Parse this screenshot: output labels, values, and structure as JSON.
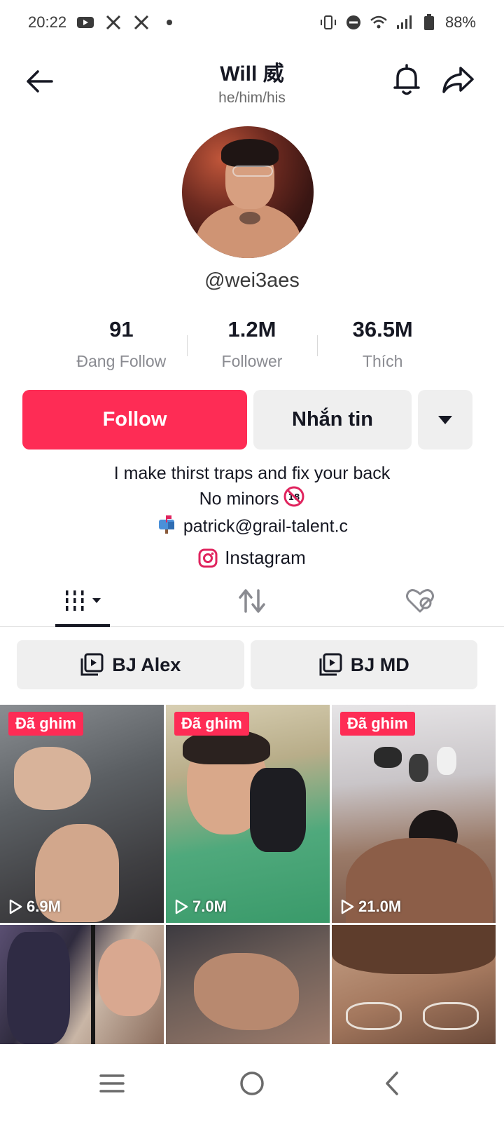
{
  "status_bar": {
    "time": "20:22",
    "battery": "88%",
    "icons_left": [
      "youtube-icon",
      "x-icon",
      "x-icon",
      "dot-icon"
    ],
    "icons_right": [
      "vibrate-icon",
      "dnd-icon",
      "wifi-icon",
      "signal-icon",
      "battery-icon"
    ]
  },
  "header": {
    "title": "Will 威",
    "pronouns": "he/him/his"
  },
  "profile": {
    "username": "@wei3aes"
  },
  "stats": [
    {
      "value": "91",
      "label": "Đang Follow"
    },
    {
      "value": "1.2M",
      "label": "Follower"
    },
    {
      "value": "36.5M",
      "label": "Thích"
    }
  ],
  "actions": {
    "follow": "Follow",
    "message": "Nhắn tin"
  },
  "bio": {
    "line1": "I make thirst traps and fix your back",
    "line2": "No minors",
    "line3": "patrick@grail-talent.c",
    "link": "Instagram"
  },
  "playlists": [
    {
      "label": "BJ Alex"
    },
    {
      "label": "BJ MD"
    }
  ],
  "videos": [
    {
      "pinned": "Đã ghim",
      "views": "6.9M"
    },
    {
      "pinned": "Đã ghim",
      "views": "7.0M"
    },
    {
      "pinned": "Đã ghim",
      "views": "21.0M"
    },
    {
      "pinned": "",
      "views": ""
    },
    {
      "pinned": "",
      "views": ""
    },
    {
      "pinned": "",
      "views": ""
    }
  ],
  "colors": {
    "accent": "#fe2c55",
    "button_gray": "#efefef",
    "text_primary": "#161823",
    "text_secondary": "#8a8b91"
  }
}
